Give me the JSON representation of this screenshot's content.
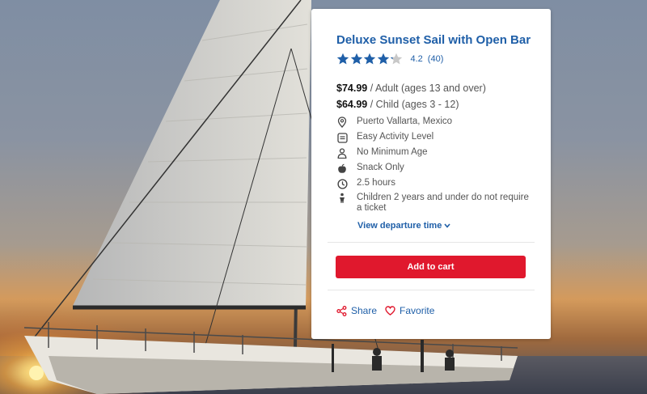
{
  "tour": {
    "title": "Deluxe Sunset Sail with Open Bar",
    "rating": {
      "value": "4.2",
      "count": "(40)",
      "stars_filled": 4.2,
      "stars_max": 5
    },
    "prices": [
      {
        "amount": "$74.99",
        "label": "/ Adult (ages 13 and over)"
      },
      {
        "amount": "$64.99",
        "label": "/ Child (ages 3 - 12)"
      }
    ],
    "features": [
      {
        "icon": "location-pin-icon",
        "text": "Puerto Vallarta, Mexico"
      },
      {
        "icon": "activity-level-icon",
        "text": "Easy Activity Level"
      },
      {
        "icon": "person-icon",
        "text": "No Minimum Age"
      },
      {
        "icon": "apple-icon",
        "text": "Snack Only"
      },
      {
        "icon": "clock-icon",
        "text": "2.5 hours"
      },
      {
        "icon": "child-icon",
        "text": "Children 2 years and under do not require a ticket"
      }
    ],
    "departure_link": "View departure time",
    "add_to_cart": "Add to cart",
    "share_label": "Share",
    "favorite_label": "Favorite"
  },
  "colors": {
    "link_blue": "#1f5fa8",
    "cart_red": "#e0182d",
    "star_blue": "#1f5fa8",
    "star_empty": "#c8c8c8",
    "share_red": "#e0182d"
  }
}
